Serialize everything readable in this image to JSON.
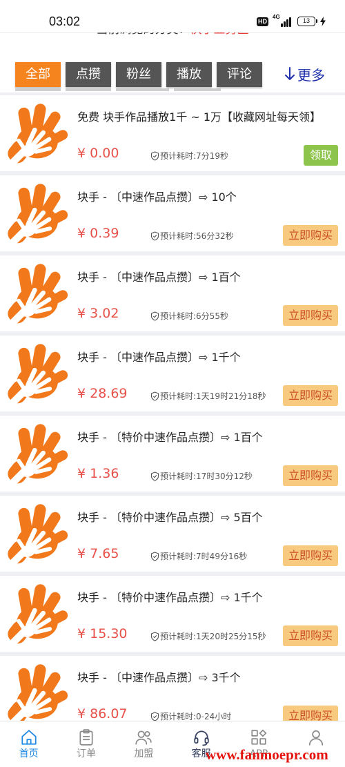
{
  "status_bar": {
    "time": "03:02",
    "hd_label": "HD",
    "network": "4G",
    "battery": "13",
    "icons": [
      "hd-icon",
      "signal-icon",
      "battery-icon",
      "charging-bolt-icon"
    ]
  },
  "header": {
    "category_prefix": "当前浏览的分类：",
    "category_name": "快手业务区"
  },
  "tabs": [
    {
      "label": "全部",
      "active": true
    },
    {
      "label": "点攒",
      "active": false
    },
    {
      "label": "粉丝",
      "active": false
    },
    {
      "label": "播放",
      "active": false
    },
    {
      "label": "评论",
      "active": false
    }
  ],
  "more": {
    "label": "更多",
    "icon": "arrow-down-icon"
  },
  "products": [
    {
      "title": "免费 块手作品播放1千 ~ 1万【收藏网址每天领】",
      "price": "¥ 0.00",
      "eta": "预计耗时:7分19秒",
      "button_label": "领取",
      "button_type": "claim"
    },
    {
      "title": "块手 - 〔中速作品点攒〕⇨ 10个",
      "price": "¥ 0.39",
      "eta": "预计耗时:56分32秒",
      "button_label": "立即购买",
      "button_type": "buy"
    },
    {
      "title": "块手 - 〔中速作品点攒〕⇨ 1百个",
      "price": "¥ 3.02",
      "eta": "预计耗时:6分55秒",
      "button_label": "立即购买",
      "button_type": "buy"
    },
    {
      "title": "块手 - 〔中速作品点攒〕⇨ 1千个",
      "price": "¥ 28.69",
      "eta": "预计耗时:1天19时21分18秒",
      "button_label": "立即购买",
      "button_type": "buy"
    },
    {
      "title": "块手 - 〔特价中速作品点攒〕⇨ 1百个",
      "price": "¥ 1.36",
      "eta": "预计耗时:17时30分12秒",
      "button_label": "立即购买",
      "button_type": "buy"
    },
    {
      "title": "块手 - 〔特价中速作品点攒〕⇨ 5百个",
      "price": "¥ 7.65",
      "eta": "预计耗时:7时49分16秒",
      "button_label": "立即购买",
      "button_type": "buy"
    },
    {
      "title": "块手 - 〔特价中速作品点攒〕⇨ 1千个",
      "price": "¥ 15.30",
      "eta": "预计耗时:1天20时25分15秒",
      "button_label": "立即购买",
      "button_type": "buy"
    },
    {
      "title": "块手 - 〔中速作品点攒〕⇨ 3千个",
      "price": "¥ 86.07",
      "eta": "预计耗时:0-24小时",
      "button_label": "立即购买",
      "button_type": "buy"
    }
  ],
  "bottom_nav": [
    {
      "label": "首页",
      "icon": "home-icon",
      "active": true
    },
    {
      "label": "订单",
      "icon": "clipboard-icon",
      "active": false
    },
    {
      "label": "加盟",
      "icon": "users-icon",
      "active": false
    },
    {
      "label": "客服",
      "icon": "headset-icon",
      "active": false
    },
    {
      "label": "APP",
      "icon": "apps-icon",
      "active": false
    },
    {
      "icon": "user-icon",
      "active": false
    }
  ],
  "watermark": "www.fanmoepr.com",
  "colors": {
    "tab_active": "#f5841f",
    "tab_inactive": "#555555",
    "price": "#e8514a",
    "buy_bg": "#f8ca80",
    "buy_text": "#cc4f28",
    "claim_bg": "#8dc44b",
    "nav_active": "#1e88e5",
    "more": "#1f2fae",
    "watermark": "#e3120b",
    "logo": "#f2781c",
    "category_name": "#e53935"
  }
}
